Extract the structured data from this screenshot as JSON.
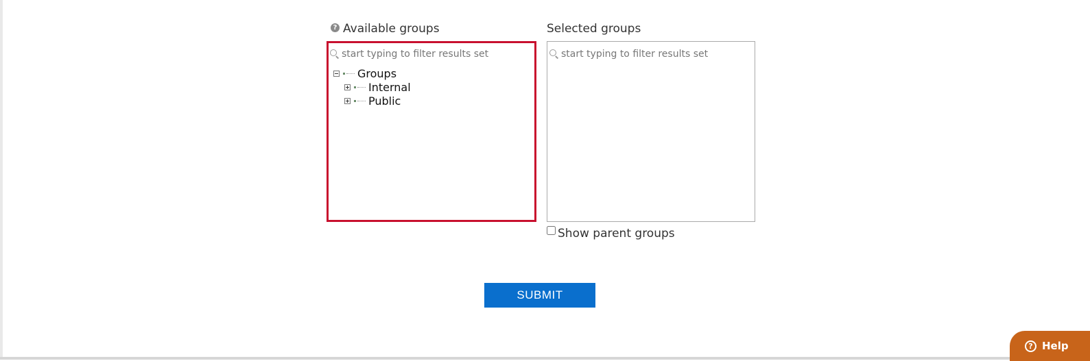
{
  "available": {
    "label": "Available groups",
    "filter_placeholder": "start typing to filter results set",
    "tree": {
      "root": "Groups",
      "children": [
        "Internal",
        "Public"
      ]
    }
  },
  "selected": {
    "label": "Selected groups",
    "filter_placeholder": "start typing to filter results set"
  },
  "show_parent_label": "Show parent groups",
  "submit_label": "SUBMIT",
  "help_label": "Help",
  "colors": {
    "highlight_border": "#c8102e",
    "submit_bg": "#0a6fcd",
    "help_bg": "#c8641a"
  }
}
